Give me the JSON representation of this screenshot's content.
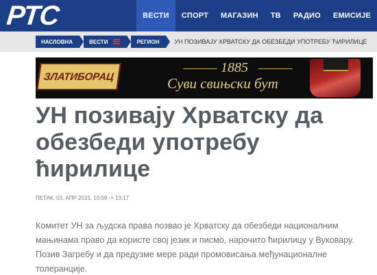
{
  "header": {
    "logo_text": "РТС",
    "nav": [
      {
        "label": "ВЕСТИ",
        "active": true
      },
      {
        "label": "СПОРТ",
        "active": false
      },
      {
        "label": "МАГАЗИН",
        "active": false
      },
      {
        "label": "ТВ",
        "active": false
      },
      {
        "label": "РАДИО",
        "active": false
      },
      {
        "label": "ЕМИСИЈЕ",
        "active": false
      }
    ]
  },
  "breadcrumb": {
    "items": [
      "НАСЛОВНА",
      "ВЕСТИ",
      "РЕГИОН"
    ],
    "current": "УН ПОЗИВАЈУ ХРВАТСКУ ДА ОБЕЗБЕДИ УПОТРЕБУ ЋИРИЛИЦЕ"
  },
  "banner": {
    "brand": "ЗЛАТИБОРАЦ",
    "year": "1885",
    "slogan": "Суви свињски бут"
  },
  "article": {
    "title": "УН позивају Хрватску да обезбеди употребу ћирилице",
    "date": "ПЕТАК, 03. АПР 2015, 10:59 -> 13:17",
    "lead": "Комитет УН за људска права позвао је Хрватску да обезбеди националним мањинама право да користе свој језик и писмо, нарочито ћирилицу у Вуковару. Позив Загребу и да предузме мере ради промовисања међунационалне толеранције."
  },
  "colors": {
    "header_bg": "#1c3e86",
    "nav_active": "#2f5bb8",
    "breadcrumb_bg": "#e6e6e6",
    "menu_icon": "#d8341e",
    "title": "#555b62"
  }
}
